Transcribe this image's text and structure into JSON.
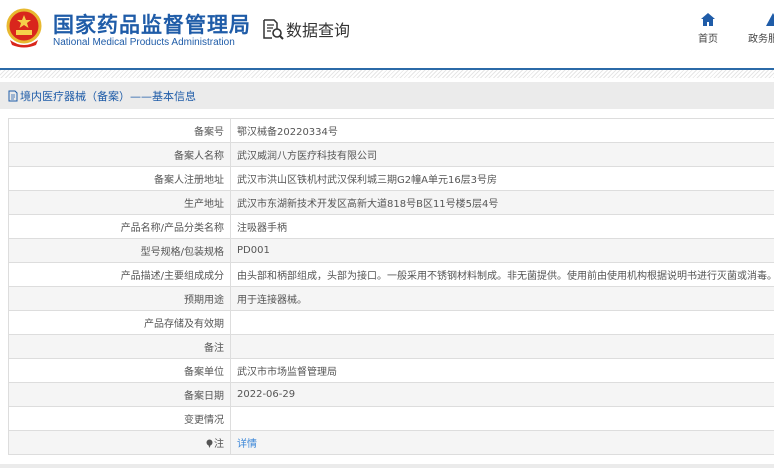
{
  "header": {
    "logo_cn": "国家药品监督管理局",
    "logo_en": "National Medical Products Administration",
    "section_title": "数据查询",
    "nav": [
      {
        "label": "首页",
        "icon": "home-icon"
      },
      {
        "label": "政务服",
        "icon": "service-icon"
      }
    ]
  },
  "breadcrumb": "境内医疗器械（备案）——基本信息",
  "rows": [
    {
      "label": "备案号",
      "value": "鄂汉械备20220334号"
    },
    {
      "label": "备案人名称",
      "value": "武汉威润八方医疗科技有限公司"
    },
    {
      "label": "备案人注册地址",
      "value": "武汉市洪山区铁机村武汉保利城三期G2幢A单元16层3号房"
    },
    {
      "label": "生产地址",
      "value": "武汉市东湖新技术开发区高新大道818号B区11号楼5层4号"
    },
    {
      "label": "产品名称/产品分类名称",
      "value": "注吸器手柄"
    },
    {
      "label": "型号规格/包装规格",
      "value": "PD001"
    },
    {
      "label": "产品描述/主要组成成分",
      "value": "由头部和柄部组成，头部为接口。一般采用不锈钢材料制成。非无菌提供。使用前由使用机构根据说明书进行灭菌或消毒。"
    },
    {
      "label": "预期用途",
      "value": "用于连接器械。"
    },
    {
      "label": "产品存储及有效期",
      "value": ""
    },
    {
      "label": "备注",
      "value": ""
    },
    {
      "label": "备案单位",
      "value": "武汉市市场监督管理局"
    },
    {
      "label": "备案日期",
      "value": "2022-06-29"
    },
    {
      "label": "变更情况",
      "value": ""
    },
    {
      "label": "注",
      "value": "详情"
    }
  ],
  "colors": {
    "brand": "#1f5ca8",
    "link": "#3a86d8"
  }
}
